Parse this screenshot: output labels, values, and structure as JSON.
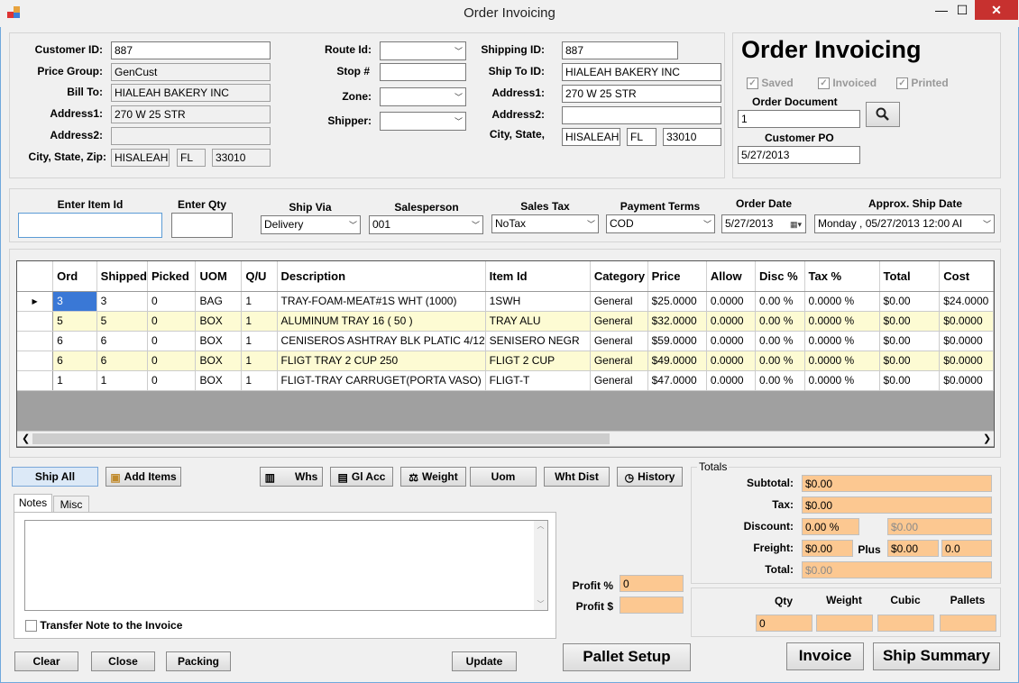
{
  "window": {
    "title": "Order Invoicing",
    "minimize": "—",
    "maximize": "☐",
    "close": "✕"
  },
  "header": {
    "customer_id": {
      "label": "Customer ID:",
      "value": "887"
    },
    "price_group": {
      "label": "Price Group:",
      "value": "GenCust"
    },
    "bill_to": {
      "label": "Bill To:",
      "value": "HIALEAH BAKERY INC"
    },
    "address1": {
      "label": "Address1:",
      "value": "270 W 25 STR"
    },
    "address2": {
      "label": "Address2:",
      "value": ""
    },
    "city_state_zip": {
      "label": "City, State, Zip:",
      "city": "HISALEAH",
      "state": "FL",
      "zip": "33010"
    },
    "route_id": {
      "label": "Route Id:",
      "value": ""
    },
    "stop": {
      "label": "Stop #",
      "value": ""
    },
    "zone": {
      "label": "Zone:",
      "value": ""
    },
    "shipper": {
      "label": "Shipper:",
      "value": ""
    },
    "shipping_id": {
      "label": "Shipping ID:",
      "value": "887"
    },
    "ship_to_id": {
      "label": "Ship To ID:",
      "value": "HIALEAH BAKERY INC"
    },
    "ship_address1": {
      "label": "Address1:",
      "value": "270 W 25 STR"
    },
    "ship_address2": {
      "label": "Address2:",
      "value": ""
    },
    "ship_city_state": {
      "label": "City, State,",
      "city": "HISALEAH",
      "state": "FL",
      "zip": "33010"
    }
  },
  "status": {
    "heading": "Order Invoicing",
    "saved": "Saved",
    "invoiced": "Invoiced",
    "printed": "Printed",
    "order_document_label": "Order Document",
    "order_document": "1",
    "customer_po_label": "Customer PO",
    "customer_po": "5/27/2013"
  },
  "entry": {
    "item_id_label": "Enter Item Id",
    "item_id": "",
    "qty_label": "Enter Qty",
    "qty": "",
    "ship_via_label": "Ship Via",
    "ship_via": "Delivery",
    "salesperson_label": "Salesperson",
    "salesperson": "001",
    "sales_tax_label": "Sales Tax",
    "sales_tax": "NoTax",
    "payment_terms_label": "Payment Terms",
    "payment_terms": "COD",
    "order_date_label": "Order Date",
    "order_date": "5/27/2013",
    "ship_date_label": "Approx. Ship  Date",
    "ship_date": "Monday   , 05/27/2013 12:00 AI"
  },
  "grid": {
    "columns": [
      "Ord",
      "Shipped",
      "Picked",
      "UOM",
      "Q/U",
      "Description",
      "Item Id",
      "Category",
      "Price",
      "Allow",
      "Disc %",
      "Tax %",
      "Total",
      "Cost"
    ],
    "rows": [
      [
        "3",
        "3",
        "0",
        "BAG",
        "1",
        "TRAY-FOAM-MEAT#1S WHT (1000)",
        "1SWH",
        "General",
        "$25.0000",
        "0.0000",
        "0.00 %",
        "0.0000 %",
        "$0.00",
        "$24.0000"
      ],
      [
        "5",
        "5",
        "0",
        "BOX",
        "1",
        "ALUMINUM TRAY 16 ( 50 )",
        "TRAY ALU",
        "General",
        "$32.0000",
        "0.0000",
        "0.00 %",
        "0.0000 %",
        "$0.00",
        "$0.0000"
      ],
      [
        "6",
        "6",
        "0",
        "BOX",
        "1",
        "CENISEROS  ASHTRAY  BLK PLATIC 4/12",
        "SENISERO NEGR",
        "General",
        "$59.0000",
        "0.0000",
        "0.00 %",
        "0.0000 %",
        "$0.00",
        "$0.0000"
      ],
      [
        "6",
        "6",
        "0",
        "BOX",
        "1",
        "FLIGT TRAY 2 CUP 250",
        "FLIGT 2 CUP",
        "General",
        "$49.0000",
        "0.0000",
        "0.00 %",
        "0.0000 %",
        "$0.00",
        "$0.0000"
      ],
      [
        "1",
        "1",
        "0",
        "BOX",
        "1",
        "FLIGT-TRAY CARRUGET(PORTA VASO)",
        "FLIGT-T",
        "General",
        "$47.0000",
        "0.0000",
        "0.00 %",
        "0.0000 %",
        "$0.00",
        "$0.0000"
      ]
    ]
  },
  "toolbar": {
    "ship_all": "Ship All",
    "add_items": "Add Items",
    "whs": "Whs",
    "gl_acc": "Gl Acc",
    "weight": "Weight",
    "uom": "Uom",
    "wht_dist": "Wht Dist",
    "history": "History"
  },
  "notes": {
    "tab_notes": "Notes",
    "tab_misc": "Misc",
    "text": "",
    "transfer_label": "Transfer Note to the Invoice"
  },
  "profit": {
    "pct_label": "Profit %",
    "pct": "0",
    "amt_label": "Profit $",
    "amt": ""
  },
  "totals": {
    "group_label": "Totals",
    "subtotal_label": "Subtotal:",
    "subtotal": "$0.00",
    "tax_label": "Tax:",
    "tax": "$0.00",
    "discount_label": "Discount:",
    "discount_pct": "0.00 %",
    "discount_amt": "$0.00",
    "freight_label": "Freight:",
    "freight": "$0.00",
    "plus_label": "Plus",
    "plus_amt": "$0.00",
    "plus_val": "0.0",
    "total_label": "Total:",
    "total": "$0.00"
  },
  "summary": {
    "qty_label": "Qty",
    "qty": "0",
    "weight_label": "Weight",
    "weight": "",
    "cubic_label": "Cubic",
    "cubic": "",
    "pallets_label": "Pallets",
    "pallets": ""
  },
  "footer": {
    "clear": "Clear",
    "close": "Close",
    "packing": "Packing",
    "update": "Update",
    "pallet_setup": "Pallet Setup",
    "invoice": "Invoice",
    "ship_summary": "Ship Summary"
  }
}
